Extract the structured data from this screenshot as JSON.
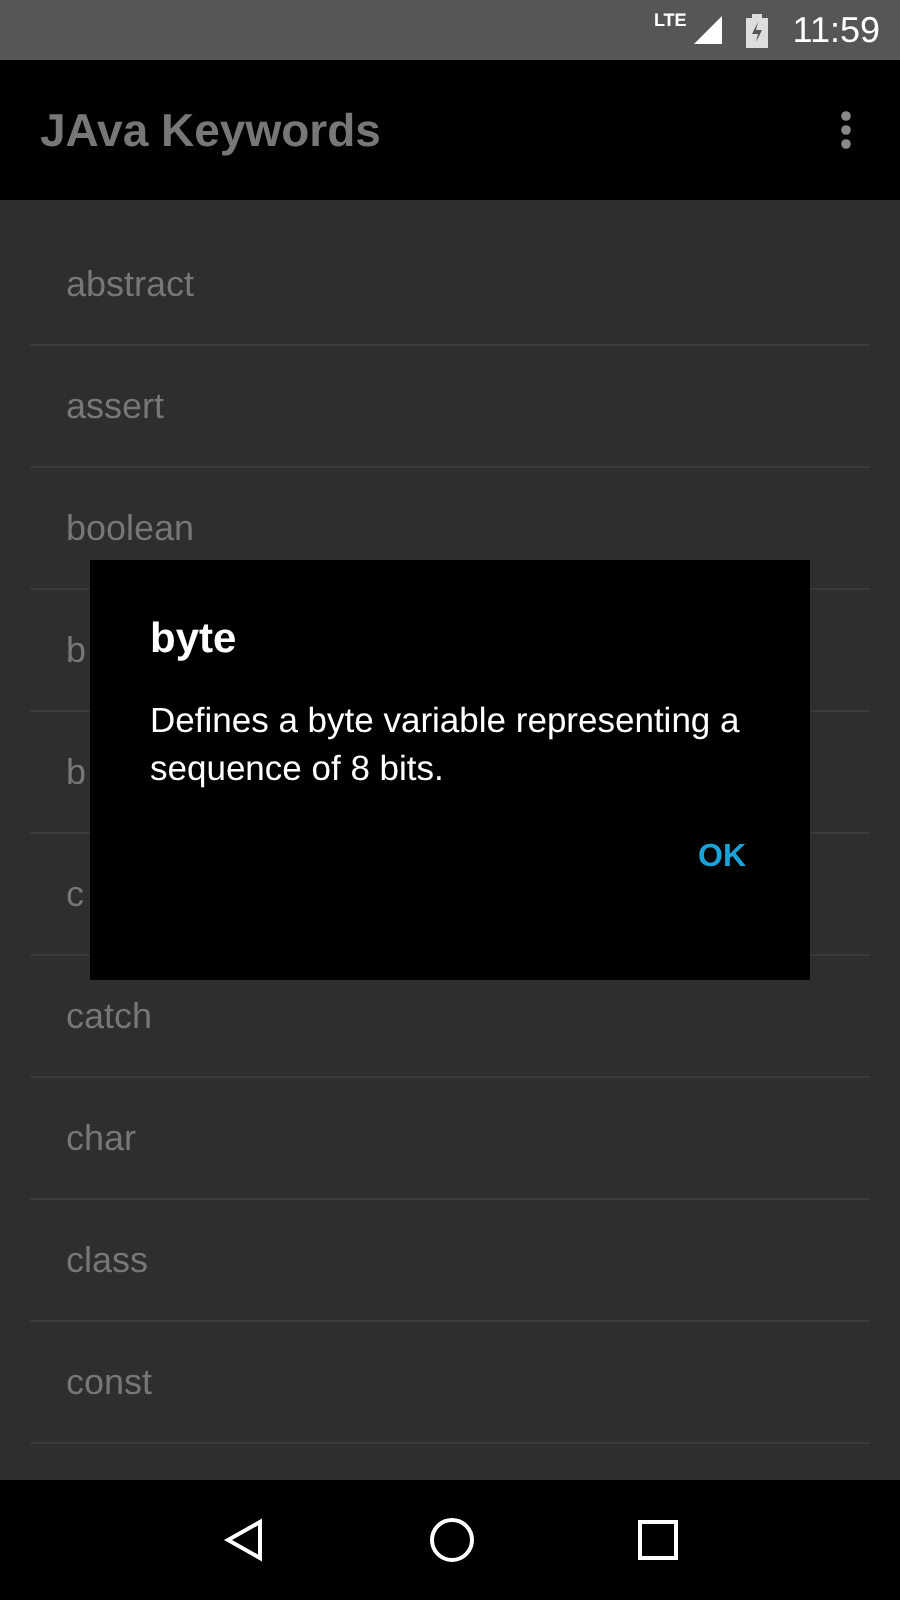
{
  "status_bar": {
    "network": "LTE",
    "time": "11:59"
  },
  "app_bar": {
    "title": "JAva Keywords"
  },
  "keywords": [
    {
      "label": "abstract"
    },
    {
      "label": "assert"
    },
    {
      "label": "boolean"
    },
    {
      "label": "b"
    },
    {
      "label": "b"
    },
    {
      "label": "c"
    },
    {
      "label": "catch"
    },
    {
      "label": "char"
    },
    {
      "label": "class"
    },
    {
      "label": "const"
    }
  ],
  "dialog": {
    "title": "byte",
    "message": "Defines a byte variable representing a sequence of 8 bits.",
    "buttons": [
      "OK"
    ]
  }
}
